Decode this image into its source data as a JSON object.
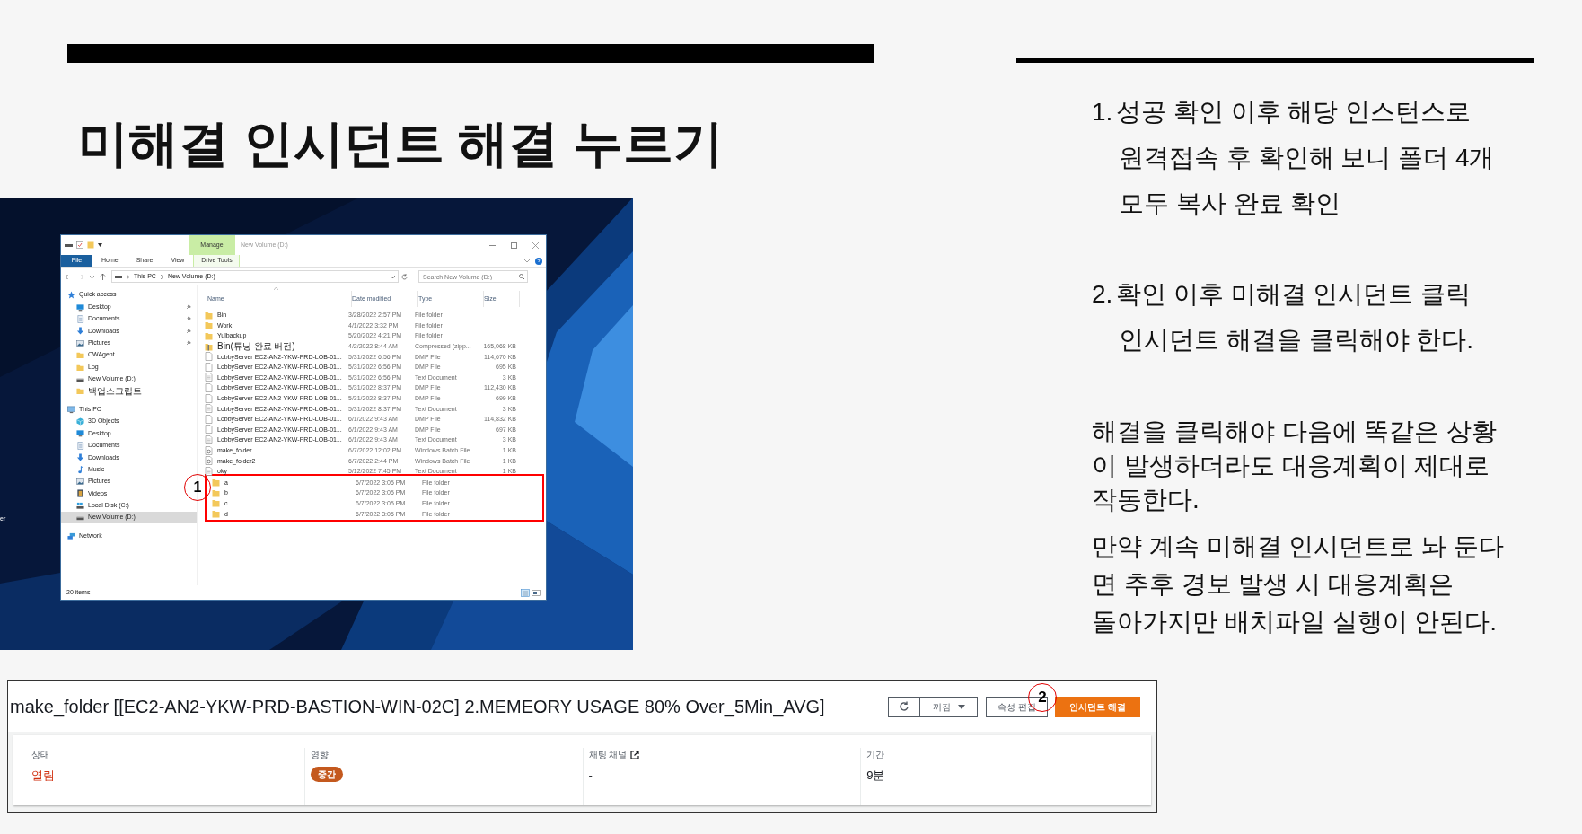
{
  "slide_title": "미해결 인시던트 해결 누르기",
  "notes": [
    {
      "kind": "numbered",
      "number": "1.",
      "lines": [
        "성공 확인 이후 해당 인스턴스로",
        "원격접속 후 확인해 보니 폴더 4개",
        "모두 복사 완료 확인"
      ]
    },
    {
      "kind": "numbered",
      "number": "2.",
      "lines": [
        "확인 이후 미해결 인시던트 클릭",
        "인시던트 해결을 클릭해야 한다."
      ]
    },
    {
      "kind": "paragraph",
      "lines": [
        "해결을 클릭해야 다음에 똑같은 상황",
        "이 발생하더라도 대응계획이 제대로",
        "작동한다."
      ]
    },
    {
      "kind": "paragraph",
      "lines": [
        "만약 계속 미해결 인시던트로 놔 둔다",
        "면 추후 경보 발생 시 대응계획은",
        "돌아가지만 배치파일 실행이 안된다."
      ]
    }
  ],
  "desktop_label": "er",
  "explorer": {
    "context_tab": "Manage",
    "title": "New Volume (D:)",
    "ribbon_tabs": [
      {
        "label": "File",
        "kind": "file"
      },
      {
        "label": "Home",
        "kind": "plain"
      },
      {
        "label": "Share",
        "kind": "plain"
      },
      {
        "label": "View",
        "kind": "plain"
      },
      {
        "label": "Drive Tools",
        "kind": "context"
      }
    ],
    "path": [
      "This PC",
      "New Volume (D:)"
    ],
    "search": {
      "placeholder": "Search New Volume (D:)"
    },
    "columns": [
      "Name",
      "Date modified",
      "Type",
      "Size"
    ],
    "nav": [
      {
        "label": "Quick access",
        "kind": "star",
        "selected": false,
        "children": [
          {
            "label": "Desktop",
            "kind": "desktop",
            "pinned": true,
            "selected": false
          },
          {
            "label": "Documents",
            "kind": "documents",
            "pinned": true,
            "selected": false
          },
          {
            "label": "Downloads",
            "kind": "downloads",
            "pinned": true,
            "selected": false
          },
          {
            "label": "Pictures",
            "kind": "pictures",
            "pinned": true,
            "selected": false
          },
          {
            "label": "CWAgent",
            "kind": "folder",
            "pinned": false,
            "selected": false
          },
          {
            "label": "Log",
            "kind": "folder",
            "pinned": false,
            "selected": false
          },
          {
            "label": "New Volume (D:)",
            "kind": "drive",
            "pinned": false,
            "selected": false
          },
          {
            "label": "백업스크립트",
            "kind": "folder",
            "pinned": false,
            "selected": false
          }
        ]
      },
      {
        "label": "This PC",
        "kind": "pc",
        "selected": false,
        "children": [
          {
            "label": "3D Objects",
            "kind": "cube",
            "selected": false
          },
          {
            "label": "Desktop",
            "kind": "desktop",
            "selected": false
          },
          {
            "label": "Documents",
            "kind": "documents",
            "selected": false
          },
          {
            "label": "Downloads",
            "kind": "downloads",
            "selected": false
          },
          {
            "label": "Music",
            "kind": "music",
            "selected": false
          },
          {
            "label": "Pictures",
            "kind": "pictures",
            "selected": false
          },
          {
            "label": "Videos",
            "kind": "videos",
            "selected": false
          },
          {
            "label": "Local Disk (C:)",
            "kind": "disk",
            "selected": false
          },
          {
            "label": "New Volume (D:)",
            "kind": "drive",
            "selected": true
          }
        ]
      },
      {
        "label": "Network",
        "kind": "network",
        "selected": false
      }
    ],
    "files": [
      {
        "name": "Bin",
        "date": "3/28/2022 2:57 PM",
        "type": "File folder",
        "kind": "folder"
      },
      {
        "name": "Work",
        "date": "4/1/2022 3:32 PM",
        "type": "File folder",
        "kind": "folder"
      },
      {
        "name": "Yulbackup",
        "date": "5/20/2022 4:21 PM",
        "type": "File folder",
        "kind": "folder"
      },
      {
        "name": "Bin(튜닝 완료 버전)",
        "date": "4/2/2022 8:44 AM",
        "type": "Compressed (zipp...",
        "size": "165,068 KB",
        "kind": "zip"
      },
      {
        "name": "LobbyServer EC2-AN2-YKW-PRD-LOB-01...",
        "date": "5/31/2022 6:56 PM",
        "type": "DMP File",
        "size": "114,670 KB",
        "kind": "dmp"
      },
      {
        "name": "LobbyServer EC2-AN2-YKW-PRD-LOB-01...",
        "date": "5/31/2022 6:56 PM",
        "type": "DMP File",
        "size": "695 KB",
        "kind": "dmp"
      },
      {
        "name": "LobbyServer EC2-AN2-YKW-PRD-LOB-01...",
        "date": "5/31/2022 6:56 PM",
        "type": "Text Document",
        "size": "3 KB",
        "kind": "text"
      },
      {
        "name": "LobbyServer EC2-AN2-YKW-PRD-LOB-01...",
        "date": "5/31/2022 8:37 PM",
        "type": "DMP File",
        "size": "112,430 KB",
        "kind": "dmp"
      },
      {
        "name": "LobbyServer EC2-AN2-YKW-PRD-LOB-01...",
        "date": "5/31/2022 8:37 PM",
        "type": "DMP File",
        "size": "699 KB",
        "kind": "dmp"
      },
      {
        "name": "LobbyServer EC2-AN2-YKW-PRD-LOB-01...",
        "date": "5/31/2022 8:37 PM",
        "type": "Text Document",
        "size": "3 KB",
        "kind": "text"
      },
      {
        "name": "LobbyServer EC2-AN2-YKW-PRD-LOB-01...",
        "date": "6/1/2022 9:43 AM",
        "type": "DMP File",
        "size": "114,832 KB",
        "kind": "dmp"
      },
      {
        "name": "LobbyServer EC2-AN2-YKW-PRD-LOB-01...",
        "date": "6/1/2022 9:43 AM",
        "type": "DMP File",
        "size": "697 KB",
        "kind": "dmp"
      },
      {
        "name": "LobbyServer EC2-AN2-YKW-PRD-LOB-01...",
        "date": "6/1/2022 9:43 AM",
        "type": "Text Document",
        "size": "3 KB",
        "kind": "text"
      },
      {
        "name": "make_folder",
        "date": "6/7/2022 12:02 PM",
        "type": "Windows Batch File",
        "size": "1 KB",
        "kind": "batch"
      },
      {
        "name": "make_folder2",
        "date": "6/7/2022 2:44 PM",
        "type": "Windows Batch File",
        "size": "1 KB",
        "kind": "batch"
      },
      {
        "name": "oky",
        "date": "5/12/2022 7:45 PM",
        "type": "Text Document",
        "size": "1 KB",
        "kind": "text"
      }
    ],
    "highlighted_files": [
      {
        "name": "a",
        "date": "6/7/2022 3:05 PM",
        "type": "File folder",
        "kind": "folder"
      },
      {
        "name": "b",
        "date": "6/7/2022 3:05 PM",
        "type": "File folder",
        "kind": "folder"
      },
      {
        "name": "c",
        "date": "6/7/2022 3:05 PM",
        "type": "File folder",
        "kind": "folder"
      },
      {
        "name": "d",
        "date": "6/7/2022 3:05 PM",
        "type": "File folder",
        "kind": "folder"
      }
    ],
    "status": "20 items",
    "marker": "1"
  },
  "incident": {
    "title": "make_folder [[EC2-AN2-YKW-PRD-BASTION-WIN-02C] 2.MEMEORY USAGE 80% Over_5Min_AVG]",
    "buttons": [
      {
        "kind": "refresh"
      },
      {
        "kind": "dropdown",
        "label": "꺼짐"
      },
      {
        "kind": "plain",
        "label": "속성 편집"
      },
      {
        "kind": "primary",
        "label": "인시던트 해결"
      }
    ],
    "marker": "2",
    "fields": [
      {
        "label": "상태",
        "value": "열림",
        "kind": "status"
      },
      {
        "label": "영향",
        "value": "중간",
        "kind": "badge"
      },
      {
        "label": "채팅 채널",
        "value": "-",
        "kind": "link"
      },
      {
        "label": "기간",
        "value": "9분",
        "kind": "plain"
      }
    ]
  }
}
